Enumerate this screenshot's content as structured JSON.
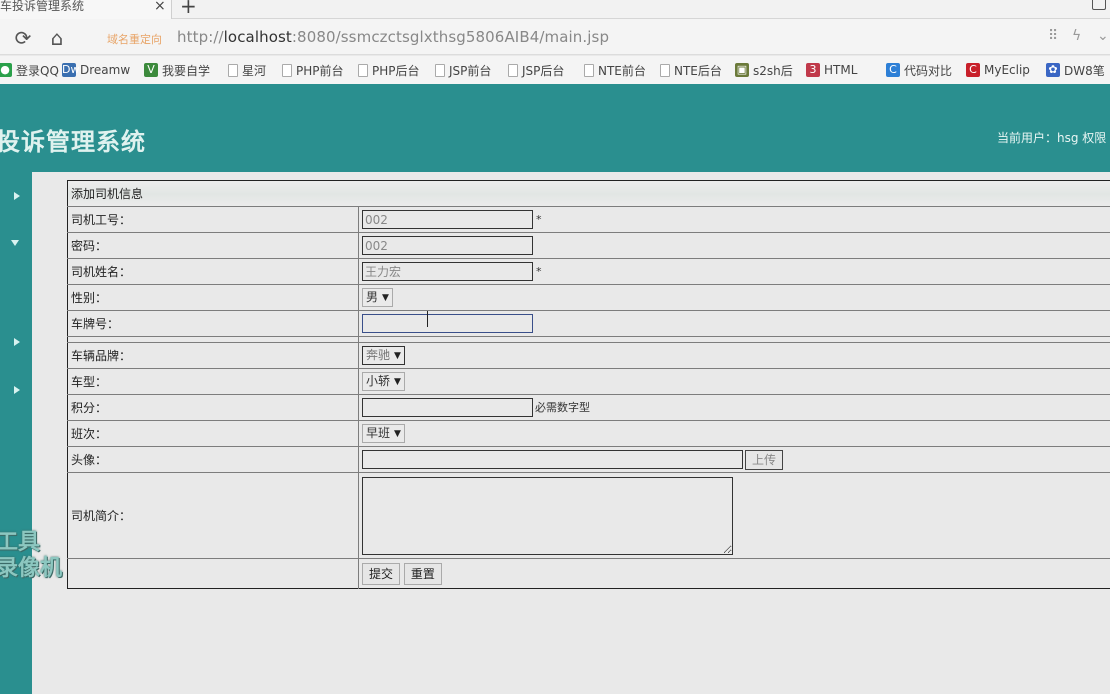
{
  "browser": {
    "tab_title": "车投诉管理系统",
    "tab_close": "×",
    "new_tab": "+",
    "redirect_label": "域名重定向",
    "url_prefix": "http://",
    "url_host": "localhost",
    "url_rest": ":8080/ssmczctsglxthsg5806AIB4/main.jsp",
    "icons": {
      "reload": "⟳",
      "home": "⌂",
      "qr": "⠿",
      "bolt": "ϟ",
      "more": "⌄"
    },
    "bookmarks": [
      {
        "label": "登录QQ",
        "icon": "qq-icon",
        "glyph": "●",
        "color": "#2aa04a"
      },
      {
        "label": "Dreamw",
        "icon": "dreamweaver-icon",
        "glyph": "Dw",
        "color": "#3a6fb0"
      },
      {
        "label": "我要自学",
        "icon": "vue-icon",
        "glyph": "V",
        "color": "#3c8a3c"
      },
      {
        "label": "星河",
        "icon": "page-icon"
      },
      {
        "label": "PHP前台",
        "icon": "page-icon"
      },
      {
        "label": "PHP后台",
        "icon": "page-icon"
      },
      {
        "label": "JSP前台",
        "icon": "page-icon"
      },
      {
        "label": "JSP后台",
        "icon": "page-icon"
      },
      {
        "label": "NTE前台",
        "icon": "page-icon"
      },
      {
        "label": "NTE后台",
        "icon": "page-icon"
      },
      {
        "label": "s2sh后",
        "icon": "image-icon",
        "glyph": "▣",
        "color": "#6b7a3a"
      },
      {
        "label": "HTML",
        "icon": "html-icon",
        "glyph": "3",
        "color": "#c0394a"
      },
      {
        "label": "代码对比",
        "icon": "compare-icon",
        "glyph": "C",
        "color": "#2d7fd6"
      },
      {
        "label": "MyEclip",
        "icon": "myeclipse-icon",
        "glyph": "C",
        "color": "#c8202a"
      },
      {
        "label": "DW8笔",
        "icon": "paw-icon",
        "glyph": "✿",
        "color": "#3a66c4"
      }
    ]
  },
  "header": {
    "system_title": "投诉管理系统",
    "user_info": "当前用户：hsg  权限"
  },
  "form": {
    "caption": "添加司机信息",
    "fields": {
      "driver_no": {
        "label": "司机工号：",
        "value": "002",
        "required": "*"
      },
      "password": {
        "label": "密码：",
        "value": "002"
      },
      "driver_name": {
        "label": "司机姓名：",
        "value": "王力宏",
        "required": "*"
      },
      "gender": {
        "label": "性别：",
        "selected": "男"
      },
      "plate_no": {
        "label": "车牌号：",
        "value": ""
      },
      "brand": {
        "label": "车辆品牌：",
        "selected": "奔驰"
      },
      "car_type": {
        "label": "车型：",
        "selected": "小轿"
      },
      "points": {
        "label": "积分：",
        "value": "",
        "hint": "必需数字型"
      },
      "shift": {
        "label": "班次：",
        "selected": "早班"
      },
      "avatar": {
        "label": "头像：",
        "value": "",
        "upload_button": "上传"
      },
      "intro": {
        "label": "司机简介：",
        "value": ""
      }
    },
    "submit_button": "提交",
    "reset_button": "重置"
  },
  "watermark": {
    "line1": "工具",
    "line2": "录像机"
  }
}
